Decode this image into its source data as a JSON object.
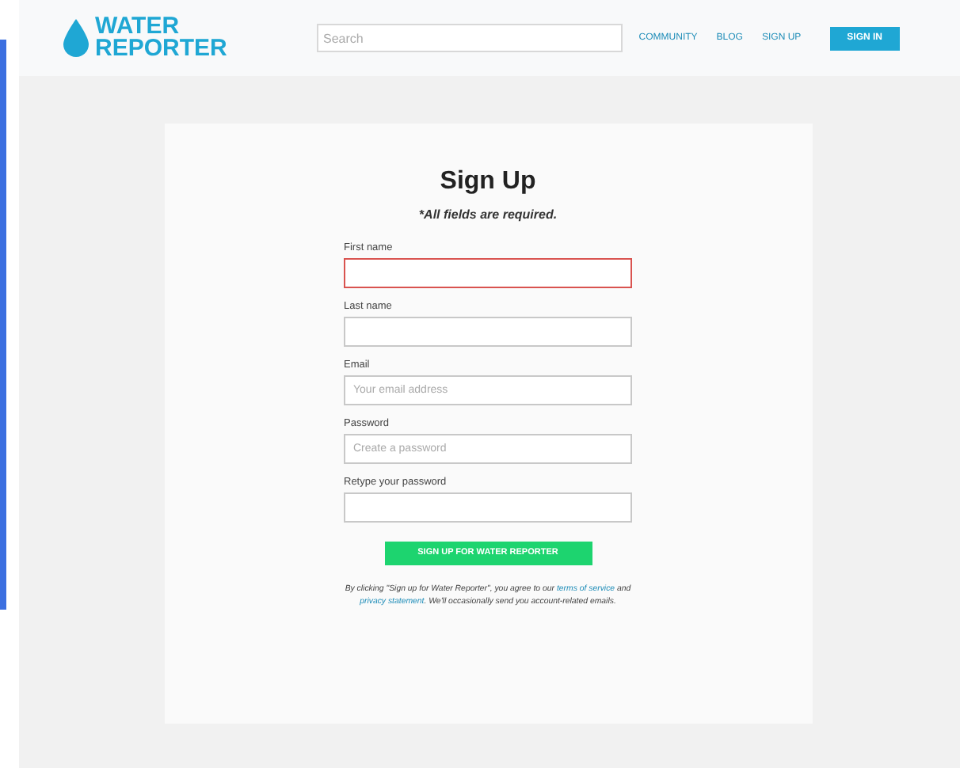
{
  "header": {
    "logo": {
      "line_1": "WATER",
      "line_2": "REPORTER"
    },
    "search": {
      "placeholder": "Search"
    },
    "nav": [
      {
        "label": "COMMUNITY",
        "kind": "link"
      },
      {
        "label": "BLOG",
        "kind": "link"
      },
      {
        "label": "SIGN UP",
        "kind": "link"
      },
      {
        "label": "SIGN IN",
        "kind": "button"
      }
    ]
  },
  "form": {
    "title": "Sign Up",
    "note": "*All fields are required.",
    "fields": [
      {
        "label": "First name",
        "invalid": true
      },
      {
        "label": "Last name",
        "invalid": false
      },
      {
        "label": "Email",
        "placeholder": "Your email address",
        "invalid": false
      },
      {
        "label": "Password",
        "placeholder": "Create a password",
        "invalid": false
      },
      {
        "label": "Retype your password",
        "invalid": false
      }
    ],
    "submit": "SIGN UP FOR WATER REPORTER",
    "legal": [
      {
        "text": "By clicking \"Sign up for Water Reporter\", you agree to our",
        "kind": "text"
      },
      {
        "text": "terms of service",
        "kind": "link"
      },
      {
        "text": "and",
        "kind": "text"
      },
      {
        "text": "privacy statement",
        "kind": "link"
      },
      {
        "text": ". We'll occasionally send you account-related emails.",
        "kind": "text"
      }
    ]
  }
}
